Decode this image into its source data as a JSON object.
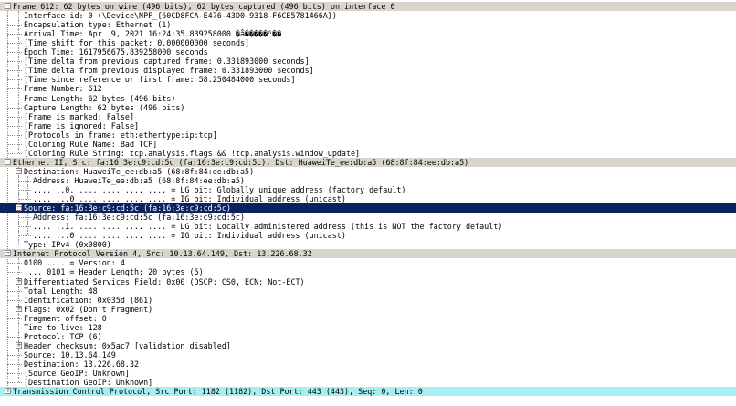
{
  "tree": {
    "rows": [
      {
        "text": "Frame 612: 62 bytes on wire (496 bits), 62 bytes captured (496 bits) on interface 0",
        "level": 0,
        "expander": "-",
        "hl": "gray"
      },
      {
        "text": "Interface id: 0 (\\Device\\NPF_{60CD8FCA-E476-43D0-9318-F6CE5781466A})",
        "level": 1
      },
      {
        "text": "Encapsulation type: Ethernet (1)",
        "level": 1
      },
      {
        "text": "Arrival Time: Apr  9, 2021 16:24:35.839258000 �ǻ�����ʱ��",
        "level": 1
      },
      {
        "text": "[Time shift for this packet: 0.000000000 seconds]",
        "level": 1
      },
      {
        "text": "Epoch Time: 1617956675.839258000 seconds",
        "level": 1
      },
      {
        "text": "[Time delta from previous captured frame: 0.331893000 seconds]",
        "level": 1
      },
      {
        "text": "[Time delta from previous displayed frame: 0.331893000 seconds]",
        "level": 1
      },
      {
        "text": "[Time since reference or first frame: 58.250484000 seconds]",
        "level": 1
      },
      {
        "text": "Frame Number: 612",
        "level": 1
      },
      {
        "text": "Frame Length: 62 bytes (496 bits)",
        "level": 1
      },
      {
        "text": "Capture Length: 62 bytes (496 bits)",
        "level": 1
      },
      {
        "text": "[Frame is marked: False]",
        "level": 1
      },
      {
        "text": "[Frame is ignored: False]",
        "level": 1
      },
      {
        "text": "[Protocols in frame: eth:ethertype:ip:tcp]",
        "level": 1
      },
      {
        "text": "[Coloring Rule Name: Bad TCP]",
        "level": 1
      },
      {
        "text": "[Coloring Rule String: tcp.analysis.flags && !tcp.analysis.window_update]",
        "level": 1,
        "last": true
      },
      {
        "text": "Ethernet II, Src: fa:16:3e:c9:cd:5c (fa:16:3e:c9:cd:5c), Dst: HuaweiTe_ee:db:a5 (68:8f:84:ee:db:a5)",
        "level": 0,
        "expander": "-",
        "hl": "gray"
      },
      {
        "text": "Destination: HuaweiTe_ee:db:a5 (68:8f:84:ee:db:a5)",
        "level": 1,
        "expander": "-"
      },
      {
        "text": "Address: HuaweiTe_ee:db:a5 (68:8f:84:ee:db:a5)",
        "level": 2
      },
      {
        "text": ".... ..0. .... .... .... .... = LG bit: Globally unique address (factory default)",
        "level": 2
      },
      {
        "text": ".... ...0 .... .... .... .... = IG bit: Individual address (unicast)",
        "level": 2,
        "last": true
      },
      {
        "text": "Source: fa:16:3e:c9:cd:5c (fa:16:3e:c9:cd:5c)",
        "level": 1,
        "expander": "-",
        "hl": "sel"
      },
      {
        "text": "Address: fa:16:3e:c9:cd:5c (fa:16:3e:c9:cd:5c)",
        "level": 2
      },
      {
        "text": ".... ..1. .... .... .... .... = LG bit: Locally administered address (this is NOT the factory default)",
        "level": 2
      },
      {
        "text": ".... ...0 .... .... .... .... = IG bit: Individual address (unicast)",
        "level": 2,
        "last": true
      },
      {
        "text": "Type: IPv4 (0x0800)",
        "level": 1,
        "last": true
      },
      {
        "text": "Internet Protocol Version 4, Src: 10.13.64.149, Dst: 13.226.68.32",
        "level": 0,
        "expander": "-",
        "hl": "gray"
      },
      {
        "text": "0100 .... = Version: 4",
        "level": 1
      },
      {
        "text": ".... 0101 = Header Length: 20 bytes (5)",
        "level": 1
      },
      {
        "text": "Differentiated Services Field: 0x00 (DSCP: CS0, ECN: Not-ECT)",
        "level": 1,
        "expander": "+"
      },
      {
        "text": "Total Length: 48",
        "level": 1
      },
      {
        "text": "Identification: 0x035d (861)",
        "level": 1
      },
      {
        "text": "Flags: 0x02 (Don't Fragment)",
        "level": 1,
        "expander": "+"
      },
      {
        "text": "Fragment offset: 0",
        "level": 1
      },
      {
        "text": "Time to live: 128",
        "level": 1
      },
      {
        "text": "Protocol: TCP (6)",
        "level": 1
      },
      {
        "text": "Header checksum: 0x5ac7 [validation disabled]",
        "level": 1,
        "expander": "+"
      },
      {
        "text": "Source: 10.13.64.149",
        "level": 1
      },
      {
        "text": "Destination: 13.226.68.32",
        "level": 1
      },
      {
        "text": "[Source GeoIP: Unknown]",
        "level": 1
      },
      {
        "text": "[Destination GeoIP: Unknown]",
        "level": 1,
        "last": true
      },
      {
        "text": "Transmission Control Protocol, Src Port: 1182 (1182), Dst Port: 443 (443), Seq: 0, Len: 0",
        "level": 0,
        "expander": "+",
        "hl": "cyan"
      }
    ]
  }
}
